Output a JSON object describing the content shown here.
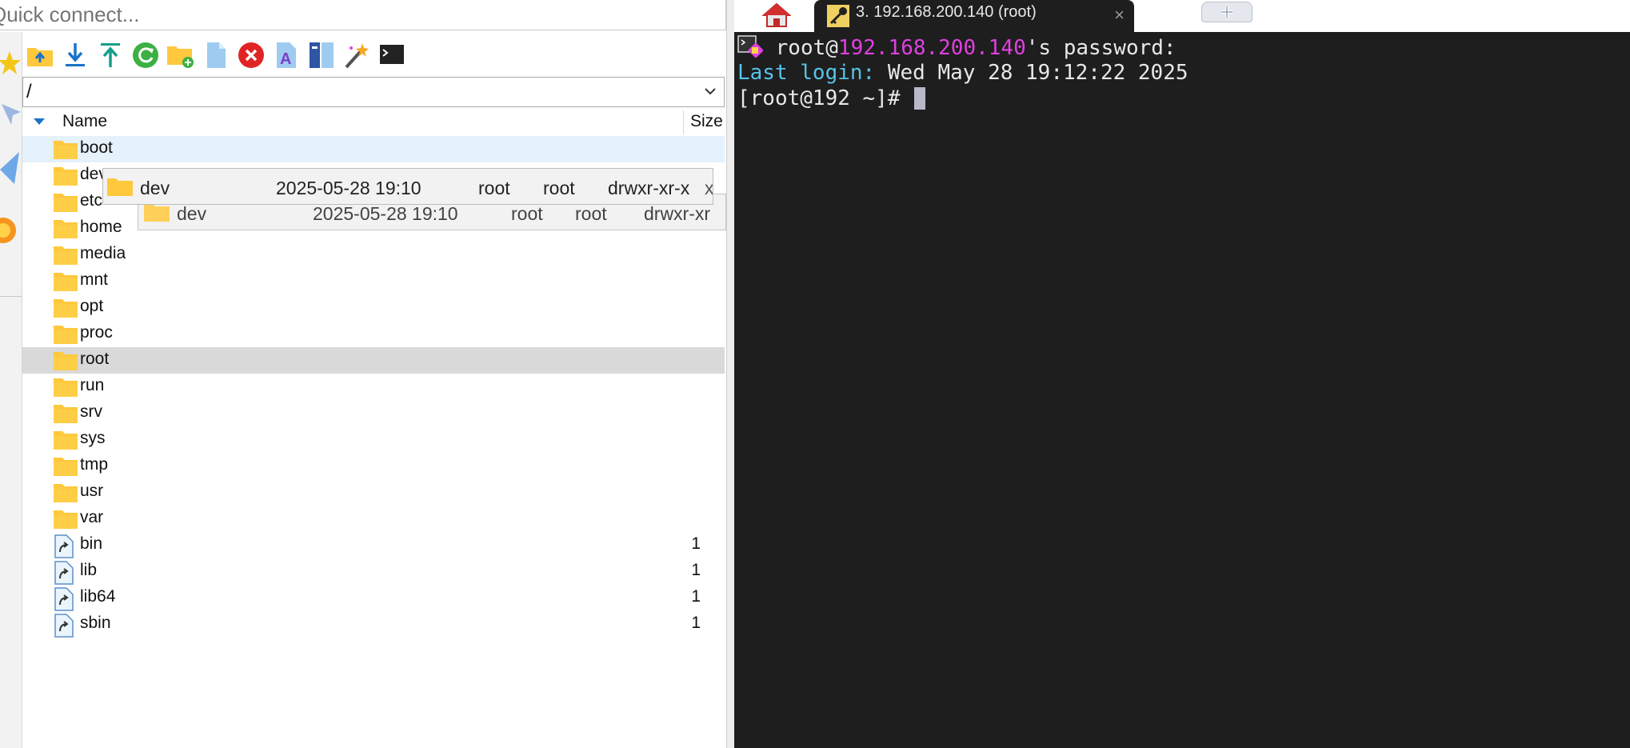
{
  "quick_connect": {
    "placeholder": "Quick connect..."
  },
  "toolbar": {
    "buttons": [
      {
        "name": "parent-folder",
        "icon": "folder-up-icon"
      },
      {
        "name": "download",
        "icon": "download-icon"
      },
      {
        "name": "upload",
        "icon": "upload-icon"
      },
      {
        "name": "refresh",
        "icon": "refresh-icon"
      },
      {
        "name": "new-folder",
        "icon": "new-folder-icon"
      },
      {
        "name": "new-file",
        "icon": "new-file-icon"
      },
      {
        "name": "delete",
        "icon": "delete-icon"
      },
      {
        "name": "rename",
        "icon": "rename-icon"
      },
      {
        "name": "properties",
        "icon": "properties-icon"
      },
      {
        "name": "magic-wand",
        "icon": "magic-wand-icon"
      },
      {
        "name": "open-terminal",
        "icon": "terminal-icon"
      }
    ]
  },
  "path": {
    "value": "/"
  },
  "columns": {
    "name": "Name",
    "size": "Size"
  },
  "files": [
    {
      "name": "boot",
      "type": "folder",
      "size": ""
    },
    {
      "name": "dev",
      "type": "folder",
      "size": ""
    },
    {
      "name": "etc",
      "type": "folder",
      "size": ""
    },
    {
      "name": "home",
      "type": "folder",
      "size": ""
    },
    {
      "name": "media",
      "type": "folder",
      "size": ""
    },
    {
      "name": "mnt",
      "type": "folder",
      "size": ""
    },
    {
      "name": "opt",
      "type": "folder",
      "size": ""
    },
    {
      "name": "proc",
      "type": "folder",
      "size": ""
    },
    {
      "name": "root",
      "type": "folder",
      "size": ""
    },
    {
      "name": "run",
      "type": "folder",
      "size": ""
    },
    {
      "name": "srv",
      "type": "folder",
      "size": ""
    },
    {
      "name": "sys",
      "type": "folder",
      "size": ""
    },
    {
      "name": "tmp",
      "type": "folder",
      "size": ""
    },
    {
      "name": "usr",
      "type": "folder",
      "size": ""
    },
    {
      "name": "var",
      "type": "folder",
      "size": ""
    },
    {
      "name": "bin",
      "type": "link",
      "size": "1"
    },
    {
      "name": "lib",
      "type": "link",
      "size": "1"
    },
    {
      "name": "lib64",
      "type": "link",
      "size": "1"
    },
    {
      "name": "sbin",
      "type": "link",
      "size": "1"
    }
  ],
  "drag_ghost": {
    "name": "dev",
    "modified": "2025-05-28 19:10",
    "owner": "root",
    "group": "root",
    "permissions": "drwxr-xr-x",
    "overflow_text": "xr"
  },
  "drag_ghost_back": {
    "name": "dev",
    "modified": "2025-05-28 19:10",
    "owner": "root",
    "group": "root",
    "permissions": "drwxr-xr"
  },
  "tabs": {
    "home_icon": "home-icon",
    "session_title": "3. 192.168.200.140 (root)",
    "close": "×",
    "new_tab_icon": "plus-icon"
  },
  "terminal": {
    "line1_prefix": " root@",
    "line1_ip": "192.168.200.140",
    "line1_suffix": "'s password:",
    "line2_label": "Last login:",
    "line2_value": " Wed May 28 19:12:22 2025",
    "line3_prompt": "[root@192 ~]# "
  },
  "colors": {
    "terminal_bg": "#1e1e1e",
    "ip": "#e040e0",
    "last_login": "#56c3e8",
    "folder": "#ffc83d"
  }
}
